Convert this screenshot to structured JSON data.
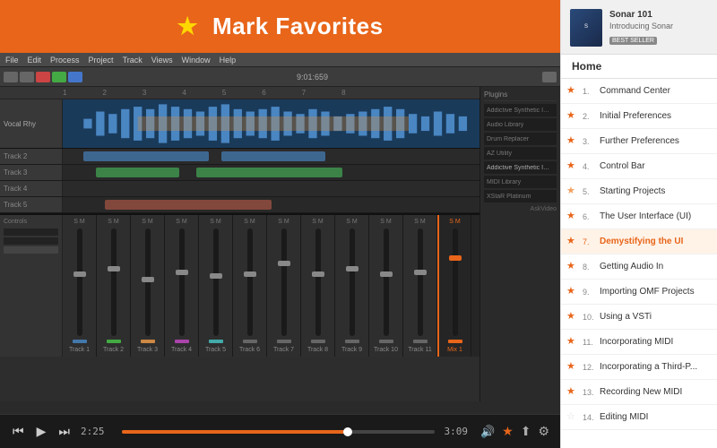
{
  "banner": {
    "star": "★",
    "title": "Mark Favorites"
  },
  "playback": {
    "current_time": "2:25",
    "end_time": "3:09",
    "progress_percent": 72
  },
  "sidebar": {
    "book_title": "Sonar 101",
    "book_subtitle": "Introducing Sonar",
    "book_badge": "BEST SELLER",
    "home_label": "Home",
    "items": [
      {
        "num": "1.",
        "label": "Command Center",
        "star": "filled"
      },
      {
        "num": "2.",
        "label": "Initial Preferences",
        "star": "filled"
      },
      {
        "num": "3.",
        "label": "Further Preferences",
        "star": "filled"
      },
      {
        "num": "4.",
        "label": "Control Bar",
        "star": "filled"
      },
      {
        "num": "5.",
        "label": "Starting Projects",
        "star": "half"
      },
      {
        "num": "6.",
        "label": "The User Interface (UI)",
        "star": "filled"
      },
      {
        "num": "7.",
        "label": "Demystifying the UI",
        "star": "filled",
        "active": true
      },
      {
        "num": "8.",
        "label": "Getting Audio In",
        "star": "filled"
      },
      {
        "num": "9.",
        "label": "Importing OMF Projects",
        "star": "filled"
      },
      {
        "num": "10.",
        "label": "Using a VSTi",
        "star": "filled"
      },
      {
        "num": "11.",
        "label": "Incorporating MIDI",
        "star": "filled"
      },
      {
        "num": "12.",
        "label": "Incorporating a Third-P...",
        "star": "filled"
      },
      {
        "num": "13.",
        "label": "Recording New MIDI",
        "star": "filled"
      },
      {
        "num": "14.",
        "label": "Editing MIDI",
        "star": "empty"
      }
    ]
  },
  "daw": {
    "menu_items": [
      "File",
      "Edit",
      "Process",
      "Project",
      "Track",
      "Views",
      "Window",
      "Help"
    ],
    "time_display": "9:01:659",
    "tracks": [
      {
        "label": "Vocal Rhy",
        "color": "#4488cc"
      },
      {
        "label": "Track 2",
        "color": "#44aa44"
      },
      {
        "label": "Track 3",
        "color": "#cc8844"
      },
      {
        "label": "Track 4",
        "color": "#aa44aa"
      },
      {
        "label": "Track 5",
        "color": "#44aaaa"
      }
    ],
    "mixer_channels": [
      "Track 1",
      "Track 2",
      "Track 3",
      "Track 4",
      "Track 5",
      "Track 6",
      "Track 7",
      "Track 8",
      "Track 9",
      "Track 10",
      "Track 11",
      "Mix 1"
    ],
    "plugins": [
      "Addictive Synthetic Impulse Response",
      "Audio Library",
      "Drum Replacer",
      "AZ Utility",
      "Addictive Synthetic Impulse Response",
      "MIDI Library",
      "XStaR Platinum"
    ]
  }
}
